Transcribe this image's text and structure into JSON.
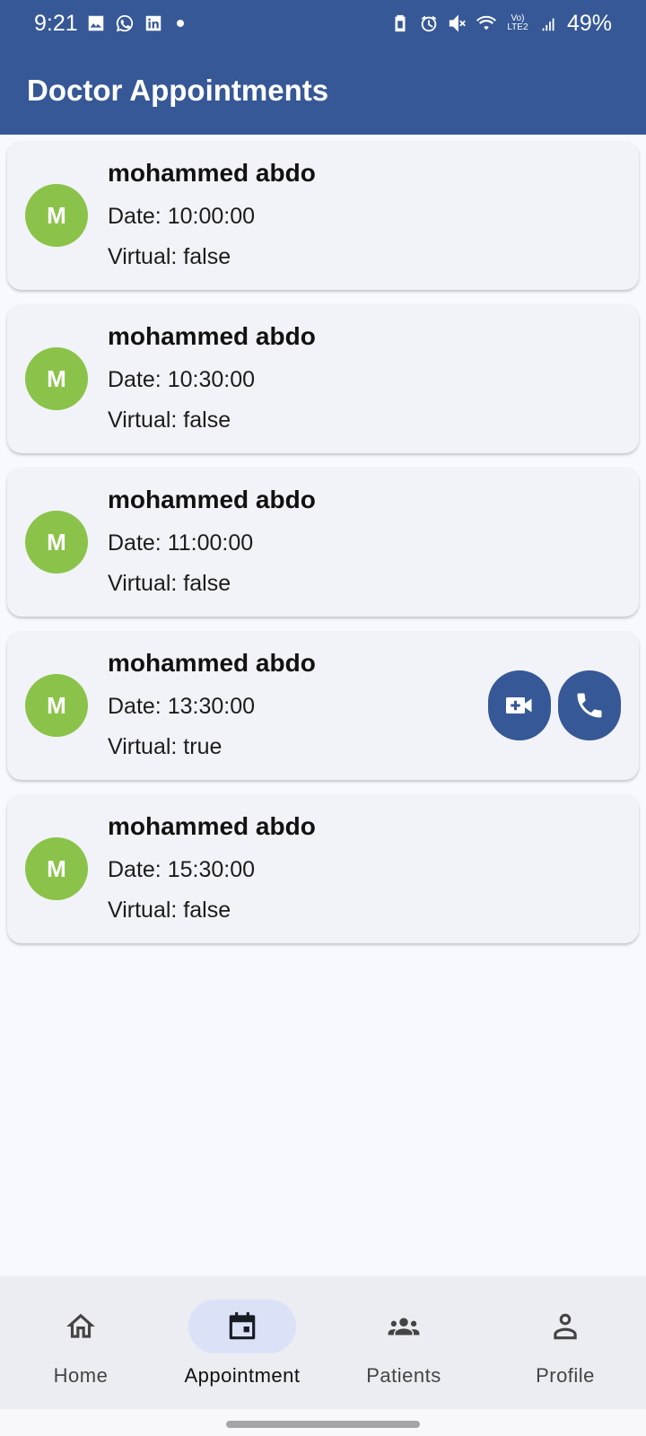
{
  "status_bar": {
    "time": "9:21",
    "left_icons": [
      "gallery-icon",
      "whatsapp-icon",
      "linkedin-icon"
    ],
    "right_icons": [
      "battery-saver-icon",
      "alarm-icon",
      "mute-icon",
      "wifi-icon",
      "volte-icon",
      "signal-icon"
    ],
    "volte_label": "Vo) LTE2",
    "battery": "49%"
  },
  "app_bar": {
    "title": "Doctor Appointments"
  },
  "colors": {
    "primary": "#365896",
    "avatar": "#8bc34a",
    "card": "#f2f3f8",
    "nav_active": "#dbe2f8"
  },
  "appointments": [
    {
      "initial": "M",
      "name": "mohammed abdo",
      "date": "Date: 10:00:00",
      "virtual": "Virtual: false"
    },
    {
      "initial": "M",
      "name": "mohammed abdo",
      "date": "Date: 10:30:00",
      "virtual": "Virtual: false"
    },
    {
      "initial": "M",
      "name": "mohammed abdo",
      "date": "Date: 11:00:00",
      "virtual": "Virtual: false"
    },
    {
      "initial": "M",
      "name": "mohammed abdo",
      "date": "Date: 13:30:00",
      "virtual": "Virtual: true",
      "actions": [
        "video-call-icon",
        "phone-icon"
      ]
    },
    {
      "initial": "M",
      "name": "mohammed abdo",
      "date": "Date: 15:30:00",
      "virtual": "Virtual: false"
    }
  ],
  "bottom_nav": {
    "items": [
      {
        "label": "Home",
        "icon": "home-icon",
        "active": false
      },
      {
        "label": "Appointment",
        "icon": "calendar-icon",
        "active": true
      },
      {
        "label": "Patients",
        "icon": "people-icon",
        "active": false
      },
      {
        "label": "Profile",
        "icon": "person-icon",
        "active": false
      }
    ]
  }
}
